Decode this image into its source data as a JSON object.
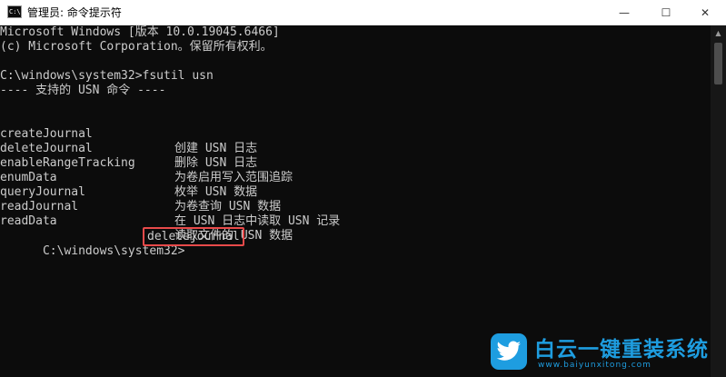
{
  "window": {
    "title": "管理员: 命令提示符",
    "app_icon_text": "C:\\",
    "minimize_glyph": "—",
    "maximize_glyph": "☐",
    "close_glyph": "✕"
  },
  "console": {
    "banner_line1": "Microsoft Windows [版本 10.0.19045.6466]",
    "banner_line2": "(c) Microsoft Corporation。保留所有权利。",
    "prompt1": "C:\\windows\\system32>fsutil usn",
    "supported_header": "---- 支持的 USN 命令 ----",
    "commands": [
      {
        "name": "createJournal",
        "desc": "创建 USN 日志"
      },
      {
        "name": "deleteJournal",
        "desc": "删除 USN 日志"
      },
      {
        "name": "enableRangeTracking",
        "desc": "为卷启用写入范围追踪"
      },
      {
        "name": "enumData",
        "desc": "枚举 USN 数据"
      },
      {
        "name": "queryJournal",
        "desc": "为卷查询 USN 数据"
      },
      {
        "name": "readJournal",
        "desc": "在 USN 日志中读取 USN 记录"
      },
      {
        "name": "readData",
        "desc": "读取文件的 USN 数据"
      }
    ],
    "prompt2": "C:\\windows\\system32>",
    "typed_command": "deletejournal"
  },
  "scrollbar": {
    "up_arrow": "▲"
  },
  "watermark": {
    "title": "白云一键重装系统",
    "url": "www.baiyunxitong.com",
    "logo_icon": "twitter-bird-icon"
  },
  "colors": {
    "console_bg": "#0c0c0c",
    "console_text": "#cccccc",
    "highlight": "#e84a4a",
    "watermark": "#1e9de0"
  }
}
